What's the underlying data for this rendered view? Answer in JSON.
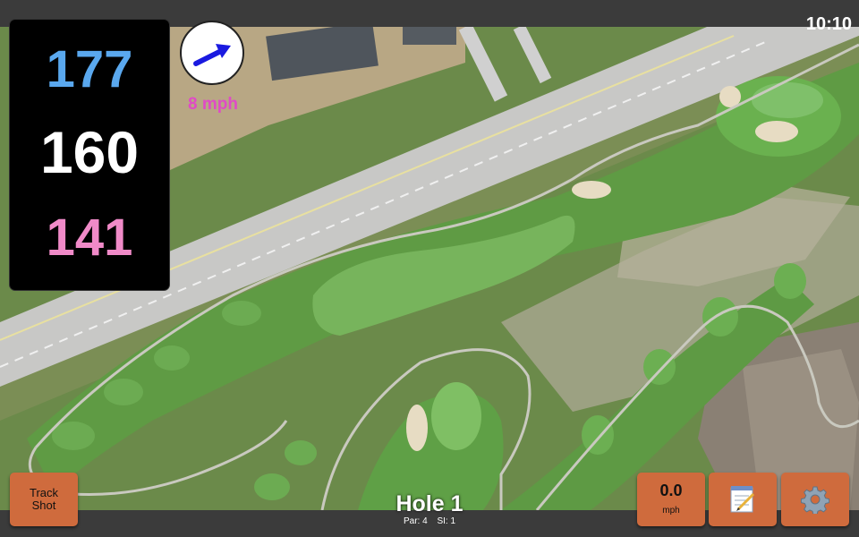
{
  "status": {
    "clock": "10:10"
  },
  "distances": {
    "back": "177",
    "center": "160",
    "front": "141",
    "back_color": "#5aa8ee",
    "center_color": "#ffffff",
    "front_color": "#f08ac8"
  },
  "wind": {
    "speed": "8 mph",
    "speed_color": "#e04bc6",
    "arrow_color": "#1a1ae0",
    "icon": "wind-arrow-icon"
  },
  "hole": {
    "title": "Hole 1",
    "par": "Par: 4",
    "si": "SI: 1"
  },
  "buttons": {
    "track_line1": "Track",
    "track_line2": "Shot",
    "speed_value": "0.0",
    "speed_unit": "mph",
    "notes_icon": "notepad-icon",
    "settings_icon": "gear-icon",
    "accent_color": "#cf6b3d"
  }
}
